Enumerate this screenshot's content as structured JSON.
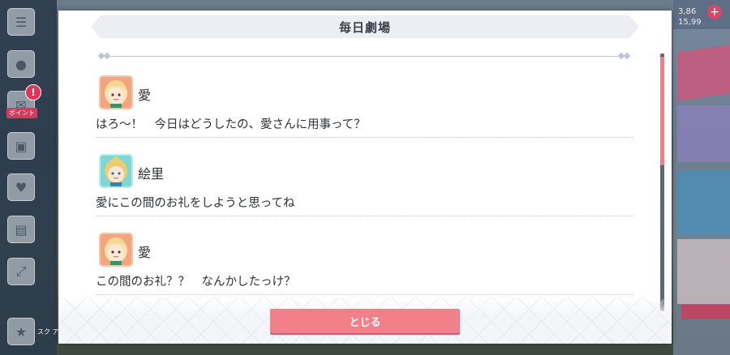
{
  "dialog": {
    "title": "毎日劇場",
    "close_label": "とじる"
  },
  "messages": [
    {
      "speaker": "愛",
      "avatar": "ai-portrait",
      "text": "はろ〜！　今日はどうしたの、愛さんに用事って？"
    },
    {
      "speaker": "絵里",
      "avatar": "eri-portrait",
      "text": "愛にこの間のお礼をしようと思ってね"
    },
    {
      "speaker": "愛",
      "avatar": "ai-portrait",
      "text": "この間のお礼？？　なんかしたっけ？"
    }
  ],
  "background": {
    "top_counter_1": "3,86",
    "top_counter_2": "15,99",
    "badge_mark": "!",
    "side_label": "ボイント",
    "side_label_bottom": "スク\nアイ"
  },
  "colors": {
    "accent_pink": "#f27f8a",
    "scroll_thumb": "#f07f8c",
    "title_bar": "#eceef4"
  }
}
